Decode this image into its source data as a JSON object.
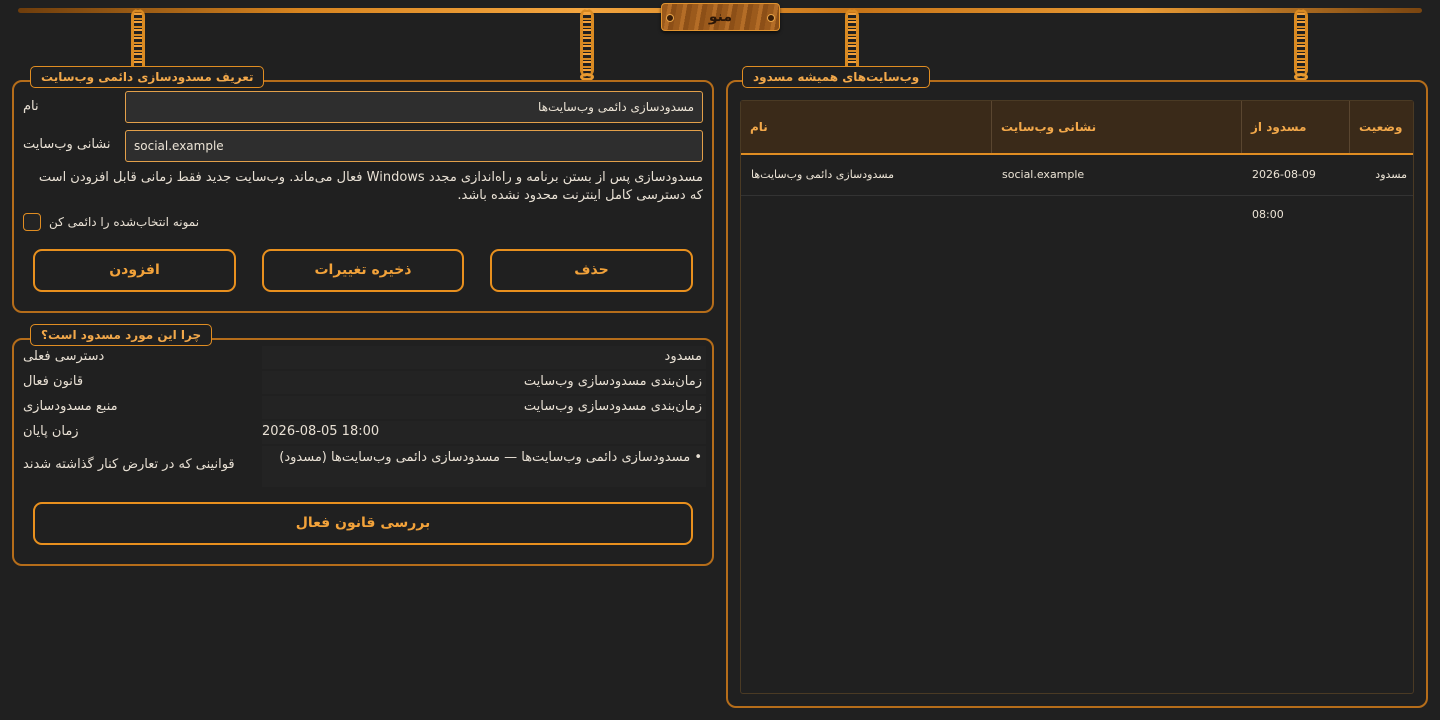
{
  "menu": {
    "label": "منو"
  },
  "definition": {
    "title": "تعریف مسدودسازی دائمی وب‌سایت",
    "name_label": "نام",
    "name_value": "مسدودسازی دائمی وب‌سایت‌ها",
    "url_label": "نشانی وب‌سایت",
    "url_value": "social.example",
    "note": "مسدودسازی پس از بستن برنامه و راه‌اندازی مجدد Windows فعال می‌ماند. وب‌سایت جدید فقط زمانی قابل افزودن است که دسترسی کامل اینترنت محدود نشده باشد.",
    "checkbox_label": "نمونه انتخاب‌شده را دائمی کن",
    "checkbox_checked": false,
    "add_label": "افزودن",
    "save_label": "ذخیره تغییرات",
    "delete_label": "حذف"
  },
  "why": {
    "title": "چرا این مورد مسدود است؟",
    "rows": [
      {
        "key": "دسترسی فعلی",
        "value": "مسدود"
      },
      {
        "key": "قانون فعال",
        "value": "زمان‌بندی مسدودسازی وب‌سایت"
      },
      {
        "key": "منبع مسدودسازی",
        "value": "زمان‌بندی مسدودسازی وب‌سایت"
      },
      {
        "key": "زمان پایان",
        "value": "2026-08-05 18:00"
      },
      {
        "key": "قوانینی که در تعارض کنار گذاشته شدند",
        "value": "• مسدودسازی دائمی وب‌سایت‌ها — مسدودسازی دائمی وب‌سایت‌ها (مسدود)"
      }
    ],
    "check_label": "بررسی قانون فعال"
  },
  "blocked_list": {
    "title": "وب‌سایت‌های همیشه مسدود",
    "columns": {
      "name": "نام",
      "url": "نشانی وب‌سایت",
      "since": "مسدود از",
      "status": "وضعیت"
    },
    "rows": [
      {
        "name": "مسدودسازی دائمی وب‌سایت‌ها",
        "url": "social.example",
        "since": "2026-08-09 08:00",
        "status": "مسدود"
      }
    ]
  },
  "colors": {
    "accent": "#e08d22",
    "background": "#202020",
    "header_bg": "#3a2a19"
  }
}
